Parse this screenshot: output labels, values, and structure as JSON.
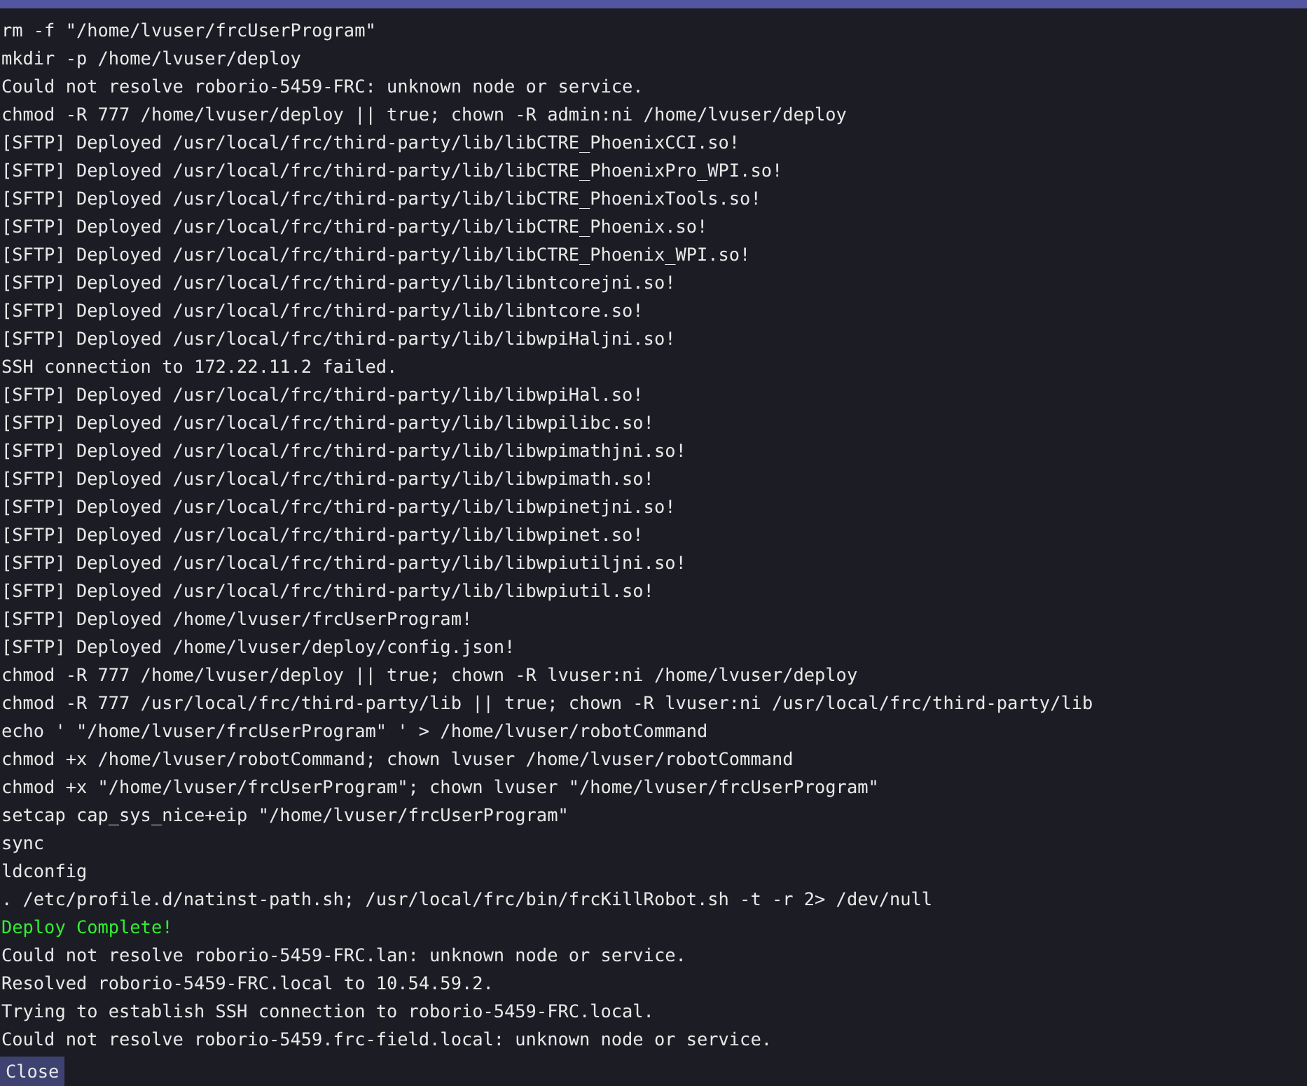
{
  "log": {
    "lines": [
      {
        "kind": "normal",
        "text": "rm -f \"/home/lvuser/frcUserProgram\""
      },
      {
        "kind": "normal",
        "text": "mkdir -p /home/lvuser/deploy"
      },
      {
        "kind": "normal",
        "text": "Could not resolve roborio-5459-FRC: unknown node or service."
      },
      {
        "kind": "normal",
        "text": "chmod -R 777 /home/lvuser/deploy || true; chown -R admin:ni /home/lvuser/deploy"
      },
      {
        "kind": "normal",
        "text": "[SFTP] Deployed /usr/local/frc/third-party/lib/libCTRE_PhoenixCCI.so!"
      },
      {
        "kind": "normal",
        "text": "[SFTP] Deployed /usr/local/frc/third-party/lib/libCTRE_PhoenixPro_WPI.so!"
      },
      {
        "kind": "normal",
        "text": "[SFTP] Deployed /usr/local/frc/third-party/lib/libCTRE_PhoenixTools.so!"
      },
      {
        "kind": "normal",
        "text": "[SFTP] Deployed /usr/local/frc/third-party/lib/libCTRE_Phoenix.so!"
      },
      {
        "kind": "normal",
        "text": "[SFTP] Deployed /usr/local/frc/third-party/lib/libCTRE_Phoenix_WPI.so!"
      },
      {
        "kind": "normal",
        "text": "[SFTP] Deployed /usr/local/frc/third-party/lib/libntcorejni.so!"
      },
      {
        "kind": "normal",
        "text": "[SFTP] Deployed /usr/local/frc/third-party/lib/libntcore.so!"
      },
      {
        "kind": "normal",
        "text": "[SFTP] Deployed /usr/local/frc/third-party/lib/libwpiHaljni.so!"
      },
      {
        "kind": "normal",
        "text": "SSH connection to 172.22.11.2 failed."
      },
      {
        "kind": "normal",
        "text": "[SFTP] Deployed /usr/local/frc/third-party/lib/libwpiHal.so!"
      },
      {
        "kind": "normal",
        "text": "[SFTP] Deployed /usr/local/frc/third-party/lib/libwpilibc.so!"
      },
      {
        "kind": "normal",
        "text": "[SFTP] Deployed /usr/local/frc/third-party/lib/libwpimathjni.so!"
      },
      {
        "kind": "normal",
        "text": "[SFTP] Deployed /usr/local/frc/third-party/lib/libwpimath.so!"
      },
      {
        "kind": "normal",
        "text": "[SFTP] Deployed /usr/local/frc/third-party/lib/libwpinetjni.so!"
      },
      {
        "kind": "normal",
        "text": "[SFTP] Deployed /usr/local/frc/third-party/lib/libwpinet.so!"
      },
      {
        "kind": "normal",
        "text": "[SFTP] Deployed /usr/local/frc/third-party/lib/libwpiutiljni.so!"
      },
      {
        "kind": "normal",
        "text": "[SFTP] Deployed /usr/local/frc/third-party/lib/libwpiutil.so!"
      },
      {
        "kind": "normal",
        "text": "[SFTP] Deployed /home/lvuser/frcUserProgram!"
      },
      {
        "kind": "normal",
        "text": "[SFTP] Deployed /home/lvuser/deploy/config.json!"
      },
      {
        "kind": "normal",
        "text": "chmod -R 777 /home/lvuser/deploy || true; chown -R lvuser:ni /home/lvuser/deploy"
      },
      {
        "kind": "normal",
        "text": "chmod -R 777 /usr/local/frc/third-party/lib || true; chown -R lvuser:ni /usr/local/frc/third-party/lib"
      },
      {
        "kind": "normal",
        "text": "echo ' \"/home/lvuser/frcUserProgram\" ' > /home/lvuser/robotCommand"
      },
      {
        "kind": "normal",
        "text": "chmod +x /home/lvuser/robotCommand; chown lvuser /home/lvuser/robotCommand"
      },
      {
        "kind": "normal",
        "text": "chmod +x \"/home/lvuser/frcUserProgram\"; chown lvuser \"/home/lvuser/frcUserProgram\""
      },
      {
        "kind": "normal",
        "text": "setcap cap_sys_nice+eip \"/home/lvuser/frcUserProgram\""
      },
      {
        "kind": "normal",
        "text": "sync"
      },
      {
        "kind": "normal",
        "text": "ldconfig"
      },
      {
        "kind": "normal",
        "text": ". /etc/profile.d/natinst-path.sh; /usr/local/frc/bin/frcKillRobot.sh -t -r 2> /dev/null"
      },
      {
        "kind": "success",
        "text": "Deploy Complete!"
      },
      {
        "kind": "normal",
        "text": "Could not resolve roborio-5459-FRC.lan: unknown node or service."
      },
      {
        "kind": "normal",
        "text": "Resolved roborio-5459-FRC.local to 10.54.59.2."
      },
      {
        "kind": "normal",
        "text": "Trying to establish SSH connection to roborio-5459-FRC.local."
      },
      {
        "kind": "normal",
        "text": "Could not resolve roborio-5459.frc-field.local: unknown node or service."
      }
    ]
  },
  "close_button": {
    "label": "Close"
  }
}
